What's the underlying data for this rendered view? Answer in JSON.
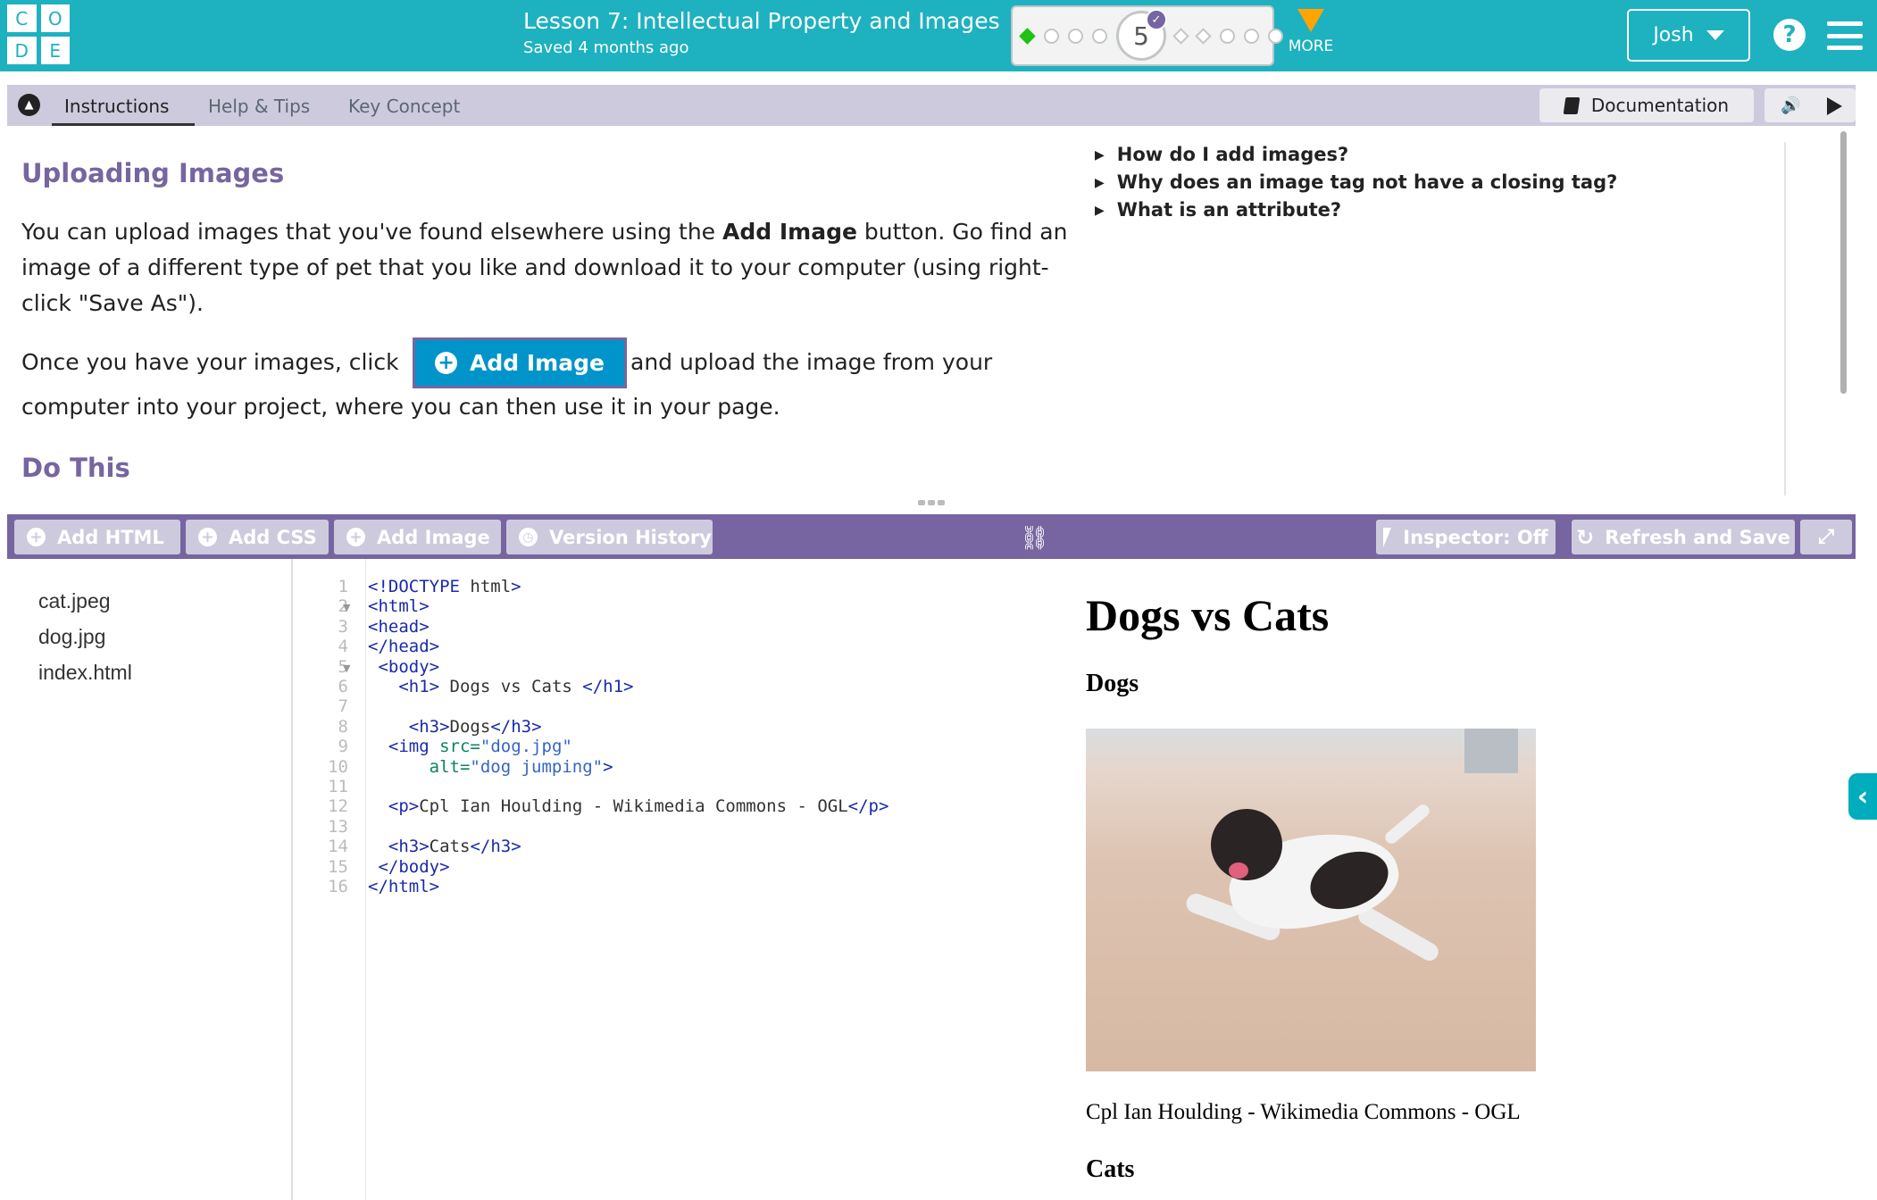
{
  "header": {
    "logo_letters": [
      "C",
      "O",
      "D",
      "E"
    ],
    "lesson_title": "Lesson 7: Intellectual Property and Images",
    "saved_text": "Saved 4 months ago",
    "progress": {
      "current_level": "5",
      "before": [
        "done",
        "bubble",
        "bubble",
        "bubble"
      ],
      "after": [
        "diamond",
        "diamond",
        "bubble",
        "bubble",
        "bubble"
      ]
    },
    "more_label": "MORE",
    "user_name": "Josh",
    "help_icon": "?"
  },
  "instructions": {
    "tabs": [
      "Instructions",
      "Help & Tips",
      "Key Concept"
    ],
    "active_tab": "Instructions",
    "documentation_label": "Documentation",
    "heading": "Uploading Images",
    "para1_before": "You can upload images that you've found elsewhere using the ",
    "para1_bold": "Add Image",
    "para1_after": " button. Go find an image of a different type of pet that you like and download it to your computer (using right-click \"Save As\").",
    "para2_before": "Once you have your images, click",
    "inline_button": "Add Image",
    "para2_after": "and upload the image from your",
    "para2_line2": "computer into your project, where you can then use it in your page.",
    "do_this": "Do This",
    "faq": [
      "How do I add images?",
      "Why does an image tag not have a closing tag?",
      "What is an attribute?"
    ]
  },
  "toolbar": {
    "add_html": "Add HTML",
    "add_css": "Add CSS",
    "add_image": "Add Image",
    "version_history": "Version History",
    "inspector": "Inspector: Off",
    "refresh_save": "Refresh and Save"
  },
  "files": [
    "cat.jpeg",
    "dog.jpg",
    "index.html"
  ],
  "code_lines": [
    "<!DOCTYPE html>",
    "<html>",
    "<head>",
    "</head>",
    " <body>",
    "   <h1> Dogs vs Cats </h1>",
    "",
    "    <h3>Dogs</h3>",
    "  <img src=\"dog.jpg\"",
    "      alt=\"dog jumping\">",
    "",
    "  <p>Cpl Ian Houlding - Wikimedia Commons - OGL</p>",
    "",
    "  <h3>Cats</h3>",
    " </body>",
    "</html>"
  ],
  "preview": {
    "h1": "Dogs vs Cats",
    "h3_dogs": "Dogs",
    "caption": "Cpl Ian Houlding - Wikimedia Commons - OGL",
    "h3_cats": "Cats"
  },
  "colors": {
    "header": "#1eb1bf",
    "accent_purple": "#7665a0",
    "tab_bar": "#cecadd",
    "add_image_blue": "#0094ca"
  }
}
